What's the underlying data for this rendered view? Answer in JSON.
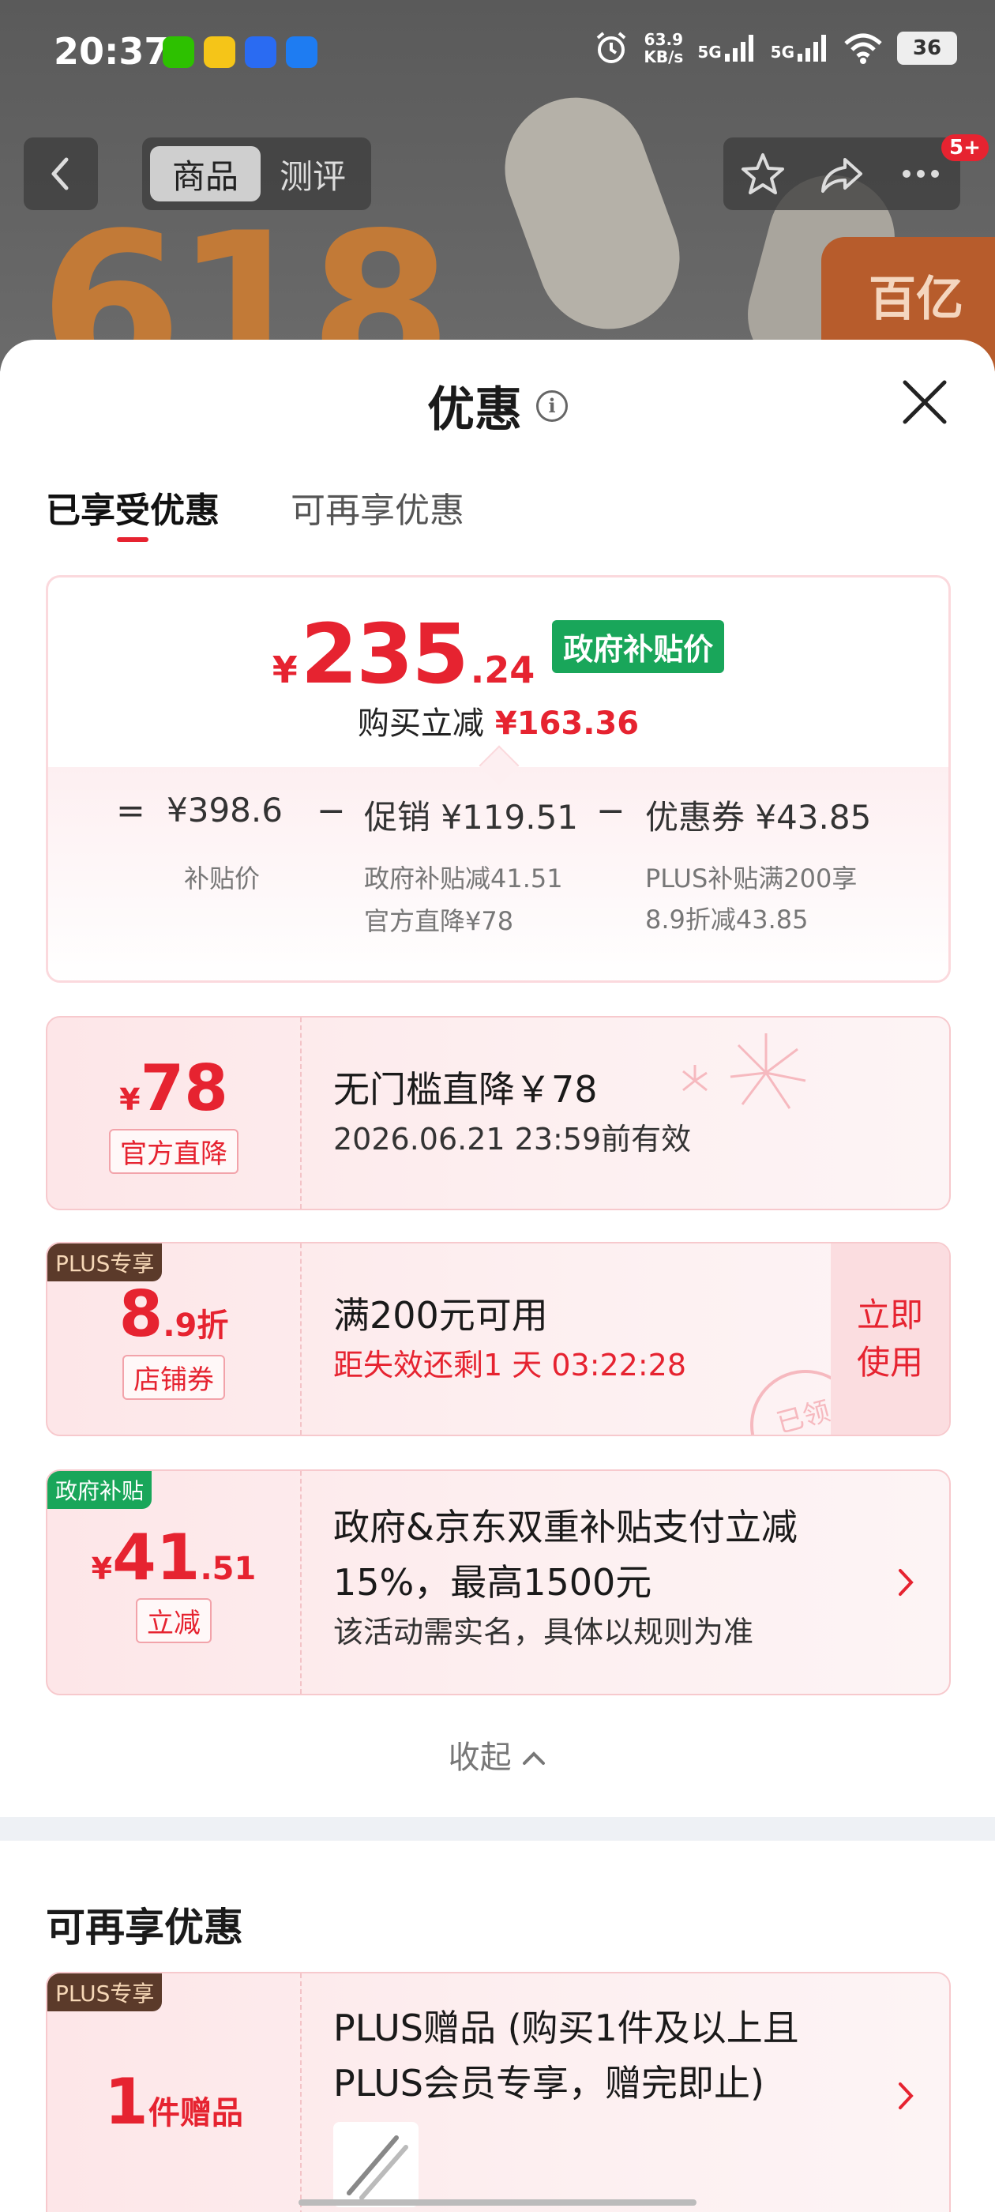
{
  "status_bar": {
    "time": "20:37",
    "speed_value": "63.9",
    "speed_unit": "KB/s",
    "net1": "5G",
    "net2": "5G",
    "battery": "36"
  },
  "nav": {
    "tab_active": "商品",
    "tab_other": "测评",
    "badge": "5+"
  },
  "background": {
    "promo_number": "618",
    "subsidy_text": "百亿"
  },
  "sheet": {
    "title": "优惠",
    "tabs": [
      "已享受优惠",
      "可再享优惠"
    ]
  },
  "summary": {
    "yen": "¥",
    "price_int": "235",
    "price_dec": ".24",
    "gov_tag": "政府补贴价",
    "reduce_label": "购买立减",
    "reduce_amount": "¥163.36",
    "eq": "=",
    "minus": "−",
    "col1_title": "¥398.6",
    "col1_sub": "补贴价",
    "col2_title": "促销 ¥119.51",
    "col2_sub1": "政府补贴减41.51",
    "col2_sub2": "官方直降¥78",
    "col3_title": "优惠券 ¥43.85",
    "col3_sub1": "PLUS补贴满200享",
    "col3_sub2": "8.9折减43.85"
  },
  "coupons": [
    {
      "yen": "¥",
      "amount": "78",
      "label": "官方直降",
      "title": "无门槛直降￥78",
      "sub": "2026.06.21 23:59前有效"
    },
    {
      "corner": "PLUS专享",
      "amount": "8",
      "amount_suffix": ".9折",
      "label": "店铺券",
      "title": "满200元可用",
      "sub": "距失效还剩1 天 03:22:28",
      "action": "立即\n使用",
      "stamp": "已领"
    },
    {
      "corner": "政府补贴",
      "yen": "¥",
      "amount": "41",
      "amount_suffix": ".51",
      "label": "立减",
      "title_line1": "政府&京东双重补贴支付立减",
      "title_line2": "15%，最高1500元",
      "sub": "该活动需实名，具体以规则为准"
    }
  ],
  "collapse_label": "收起",
  "more": {
    "section_title": "可再享优惠",
    "corner": "PLUS专享",
    "amount": "1",
    "amount_suffix": "件赠品",
    "title_line1": "PLUS赠品 (购买1件及以上且",
    "title_line2": "PLUS会员专享，赠完即止)"
  },
  "colors": {
    "accent_red": "#e62330",
    "gov_green": "#19a65a",
    "plus_brown": "#5b3a2a"
  }
}
